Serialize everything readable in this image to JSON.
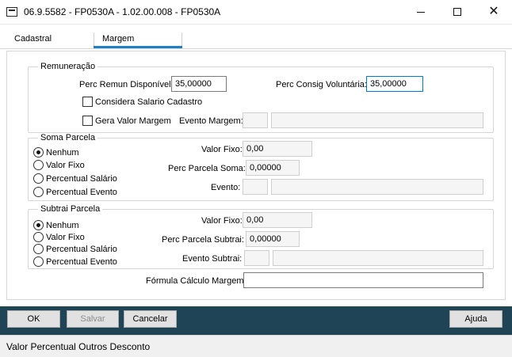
{
  "window": {
    "title": "06.9.5582 - FP0530A - 1.02.00.008 - FP0530A"
  },
  "tabs": [
    {
      "label": "Cadastral"
    },
    {
      "label": "Margem"
    }
  ],
  "remuneracao": {
    "legend": "Remuneração",
    "perc_remun_label": "Perc Remun Disponível:",
    "perc_remun_value": "35,00000",
    "perc_consig_label": "Perc Consig Voluntária:",
    "perc_consig_value": "35,00000",
    "considera_label": "Considera Salario Cadastro",
    "gera_label": "Gera Valor Margem",
    "evento_margem_label": "Evento Margem:",
    "evento_margem_code": "",
    "evento_margem_desc": ""
  },
  "soma": {
    "legend": "Soma Parcela",
    "options": [
      "Nenhum",
      "Valor Fixo",
      "Percentual Salário",
      "Percentual Evento"
    ],
    "selected": "Nenhum",
    "valor_fixo_label": "Valor Fixo:",
    "valor_fixo_value": "0,00",
    "perc_parcela_label": "Perc Parcela Soma:",
    "perc_parcela_value": "0,00000",
    "evento_label": "Evento:",
    "evento_code": "",
    "evento_desc": ""
  },
  "subtrai": {
    "legend": "Subtrai Parcela",
    "options": [
      "Nenhum",
      "Valor Fixo",
      "Percentual Salário",
      "Percentual Evento"
    ],
    "selected": "Nenhum",
    "valor_fixo_label": "Valor Fixo:",
    "valor_fixo_value": "0,00",
    "perc_parcela_label": "Perc Parcela Subtrai:",
    "perc_parcela_value": "0,00000",
    "evento_label": "Evento Subtrai:",
    "evento_code": "",
    "evento_desc": ""
  },
  "formula": {
    "label": "Fórmula Cálculo Margem:",
    "value": ""
  },
  "buttons": {
    "ok": "OK",
    "salvar": "Salvar",
    "cancelar": "Cancelar",
    "ajuda": "Ajuda"
  },
  "status_bar": "Valor Percentual Outros Desconto",
  "colors": {
    "footer_bg": "#1f4455",
    "tab_accent": "#1e7fc4",
    "focus_border": "#0078d7"
  }
}
